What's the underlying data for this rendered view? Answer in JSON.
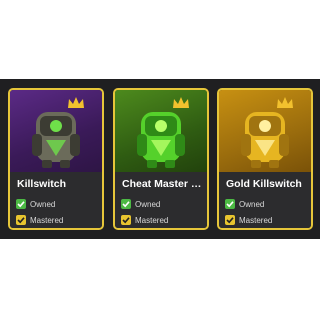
{
  "cards": [
    {
      "name": "Killswitch",
      "status_owned": "Owned",
      "status_mastered": "Mastered",
      "bg_top": "#5b2a86",
      "bg_bottom": "#2e1545",
      "skin_color": "#6b6b5a",
      "skin_dark": "#3c3c33",
      "skin_accent": "#6fe04a"
    },
    {
      "name": "Cheat Master Ki...",
      "status_owned": "Owned",
      "status_mastered": "Mastered",
      "bg_top": "#4d8a1d",
      "bg_bottom": "#22420c",
      "skin_color": "#55d12b",
      "skin_dark": "#2f8a17",
      "skin_accent": "#b8ff6a"
    },
    {
      "name": "Gold Killswitch",
      "status_owned": "Owned",
      "status_mastered": "Mastered",
      "bg_top": "#c79012",
      "bg_bottom": "#7a5208",
      "skin_color": "#e6b521",
      "skin_dark": "#a07410",
      "skin_accent": "#fff0a0"
    }
  ],
  "colors": {
    "border": "#e6c63a",
    "crown": "#f2c12e",
    "owned_check": "#4cb944",
    "mastered_check": "#e8c52f"
  }
}
